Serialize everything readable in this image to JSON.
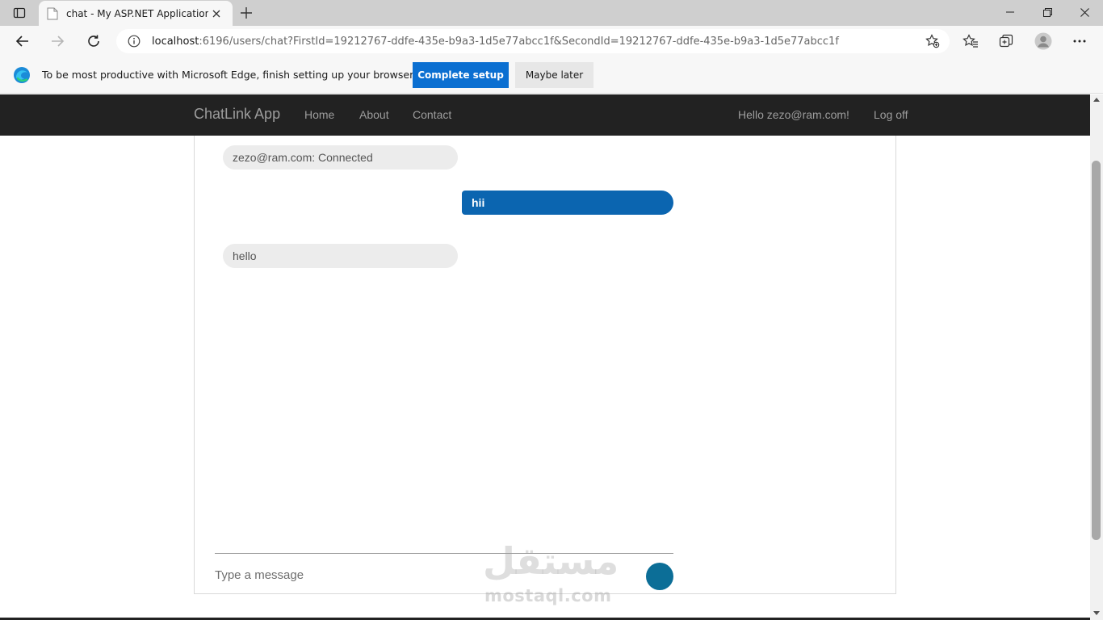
{
  "browser": {
    "tab_title": "chat - My ASP.NET Application",
    "url_host": "localhost",
    "url_rest": ":6196/users/chat?FirstId=19212767-ddfe-435e-b9a3-1d5e77abcc1f&SecondId=19212767-ddfe-435e-b9a3-1d5e77abcc1f"
  },
  "infobar": {
    "message": "To be most productive with Microsoft Edge, finish setting up your browser.",
    "primary_label": "Complete setup",
    "secondary_label": "Maybe later"
  },
  "navbar": {
    "brand": "ChatLink App",
    "links": [
      "Home",
      "About",
      "Contact"
    ],
    "greeting": "Hello zezo@ram.com!",
    "logoff": "Log off"
  },
  "chat": {
    "messages": [
      {
        "direction": "incoming",
        "text": "zezo@ram.com: Connected"
      },
      {
        "direction": "outgoing",
        "text": "hii"
      },
      {
        "direction": "incoming",
        "text": "hello"
      }
    ],
    "input_placeholder": "Type a message"
  },
  "watermark": {
    "arabic": "مستقل",
    "latin": "mostaql.com"
  },
  "colors": {
    "navbar_bg": "#222222",
    "outgoing_bubble": "#0b65b0",
    "incoming_bubble": "#ececec",
    "send_button": "#0c6e97",
    "edge_primary_button": "#0b6fd1"
  }
}
